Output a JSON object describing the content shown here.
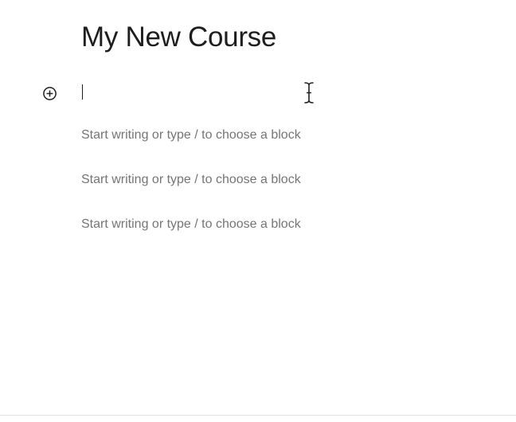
{
  "editor": {
    "post_title": "My New Course",
    "add_block_icon": "plus-circle-icon",
    "text_cursor_icon": "ibeam-cursor-icon",
    "blocks": [
      {
        "placeholder": "Start writing or type / to choose a block"
      },
      {
        "placeholder": "Start writing or type / to choose a block"
      },
      {
        "placeholder": "Start writing or type / to choose a block"
      }
    ]
  }
}
